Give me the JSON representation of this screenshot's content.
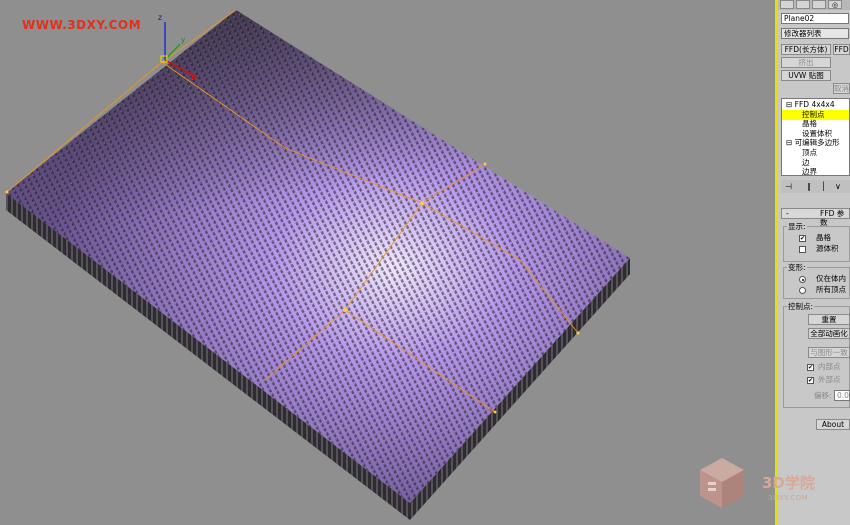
{
  "watermark": "WWW.3DXY.COM",
  "panel": {
    "tabs": [
      "",
      "",
      "",
      "◎"
    ],
    "object_name": "Plane02",
    "modifier_list": "修改器列表",
    "buttons": {
      "ffd_box": "FFD(长方体)",
      "extrude": "挤出",
      "uvw_map": "UVW 贴图",
      "extra": "取消",
      "ffd_select": "FFD"
    },
    "stack": [
      {
        "label": "⊟ FFD 4x4x4",
        "indent": 0,
        "selected": false
      },
      {
        "label": "控制点",
        "indent": 1,
        "selected": true
      },
      {
        "label": "晶格",
        "indent": 1,
        "selected": false
      },
      {
        "label": "设置体积",
        "indent": 1,
        "selected": false
      },
      {
        "label": "⊟ 可编辑多边形",
        "indent": 0,
        "selected": false
      },
      {
        "label": "顶点",
        "indent": 1,
        "selected": false
      },
      {
        "label": "边",
        "indent": 1,
        "selected": false
      },
      {
        "label": "边界",
        "indent": 1,
        "selected": false
      }
    ],
    "rollout_title": "FFD 参数",
    "display": {
      "title": "显示:",
      "lattice": "晶格",
      "lattice_checked": true,
      "source_volume": "源体积",
      "source_volume_checked": false
    },
    "deform": {
      "title": "变形:",
      "only_in_volume": "仅在体内",
      "all_vertices": "所有顶点"
    },
    "control_points": {
      "title": "控制点:",
      "reset": "重置",
      "animate_all": "全部动画化",
      "conform": "与图形一致",
      "inside": "内部点",
      "outside": "外部点",
      "offset_label": "偏移:",
      "offset_value": "0.05"
    },
    "about": "About"
  },
  "logo": {
    "text": "3D学院",
    "sub": "3DXY.COM"
  },
  "colors": {
    "viewport_bg": "#8f8f8f",
    "panel_bg": "#c8c8c8",
    "lattice": "#e8961e",
    "surface_light": "#b08ce8",
    "surface_dark": "#4c3f66",
    "highlight": "#ffff00"
  },
  "icons": [
    "light-bulb-icon",
    "pin-stack-icon",
    "show-end-icon",
    "make-unique-icon",
    "remove-modifier-icon",
    "configure-icon",
    "axis-gizmo-icon"
  ]
}
